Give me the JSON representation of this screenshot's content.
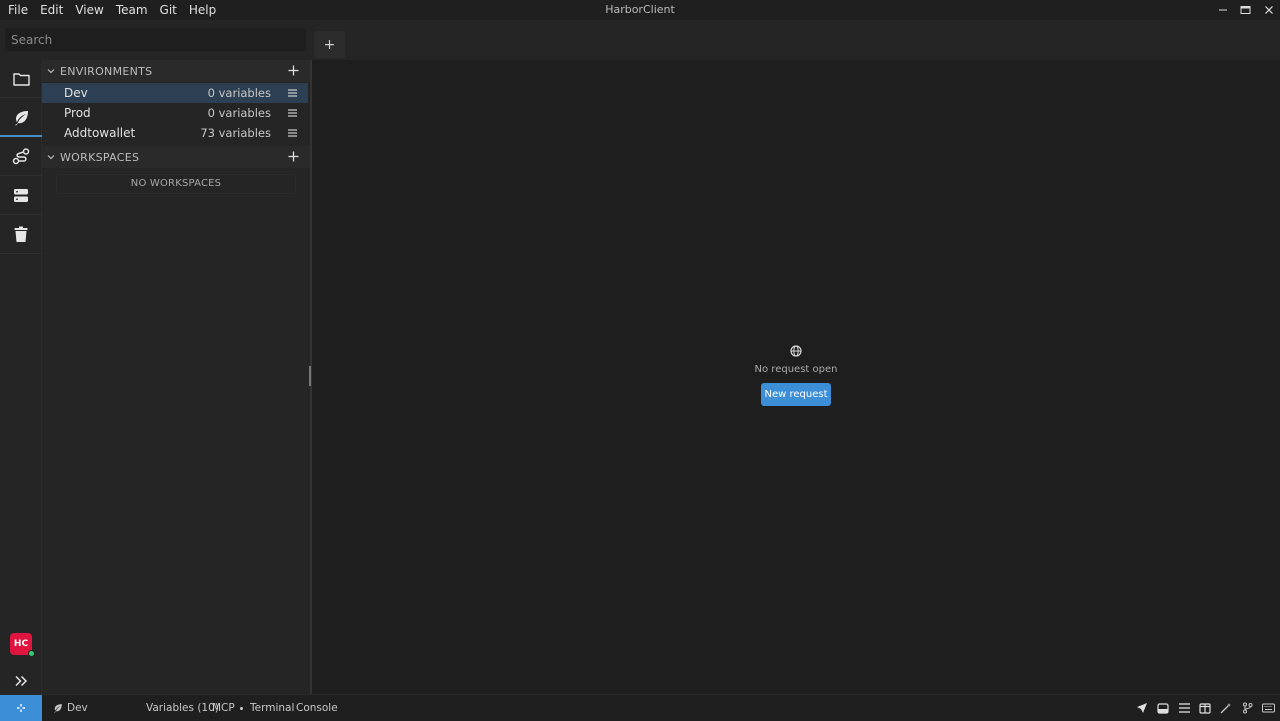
{
  "menu": [
    "File",
    "Edit",
    "View",
    "Team",
    "Git",
    "Help"
  ],
  "app_title": "HarborClient",
  "search": {
    "placeholder": "Search"
  },
  "new_tab_label": "+",
  "environments": {
    "header": "ENVIRONMENTS",
    "items": [
      {
        "name": "Dev",
        "count": "0 variables",
        "selected": true
      },
      {
        "name": "Prod",
        "count": "0 variables",
        "selected": false
      },
      {
        "name": "Addtowallet",
        "count": "73 variables",
        "selected": false
      }
    ]
  },
  "workspaces": {
    "header": "WORKSPACES",
    "empty": "NO WORKSPACES"
  },
  "main": {
    "empty_text": "No request open",
    "new_request_label": "New request"
  },
  "avatar": {
    "initials": "HC"
  },
  "status": {
    "env": "Dev",
    "variables": "Variables (10)",
    "mcp": "MCP",
    "terminal": "Terminal",
    "console": "Console"
  },
  "colors": {
    "accent": "#3c8ed6",
    "avatar_bg": "#e0153f",
    "online_dot": "#2ecc71",
    "selected_row": "#2d3f52"
  }
}
